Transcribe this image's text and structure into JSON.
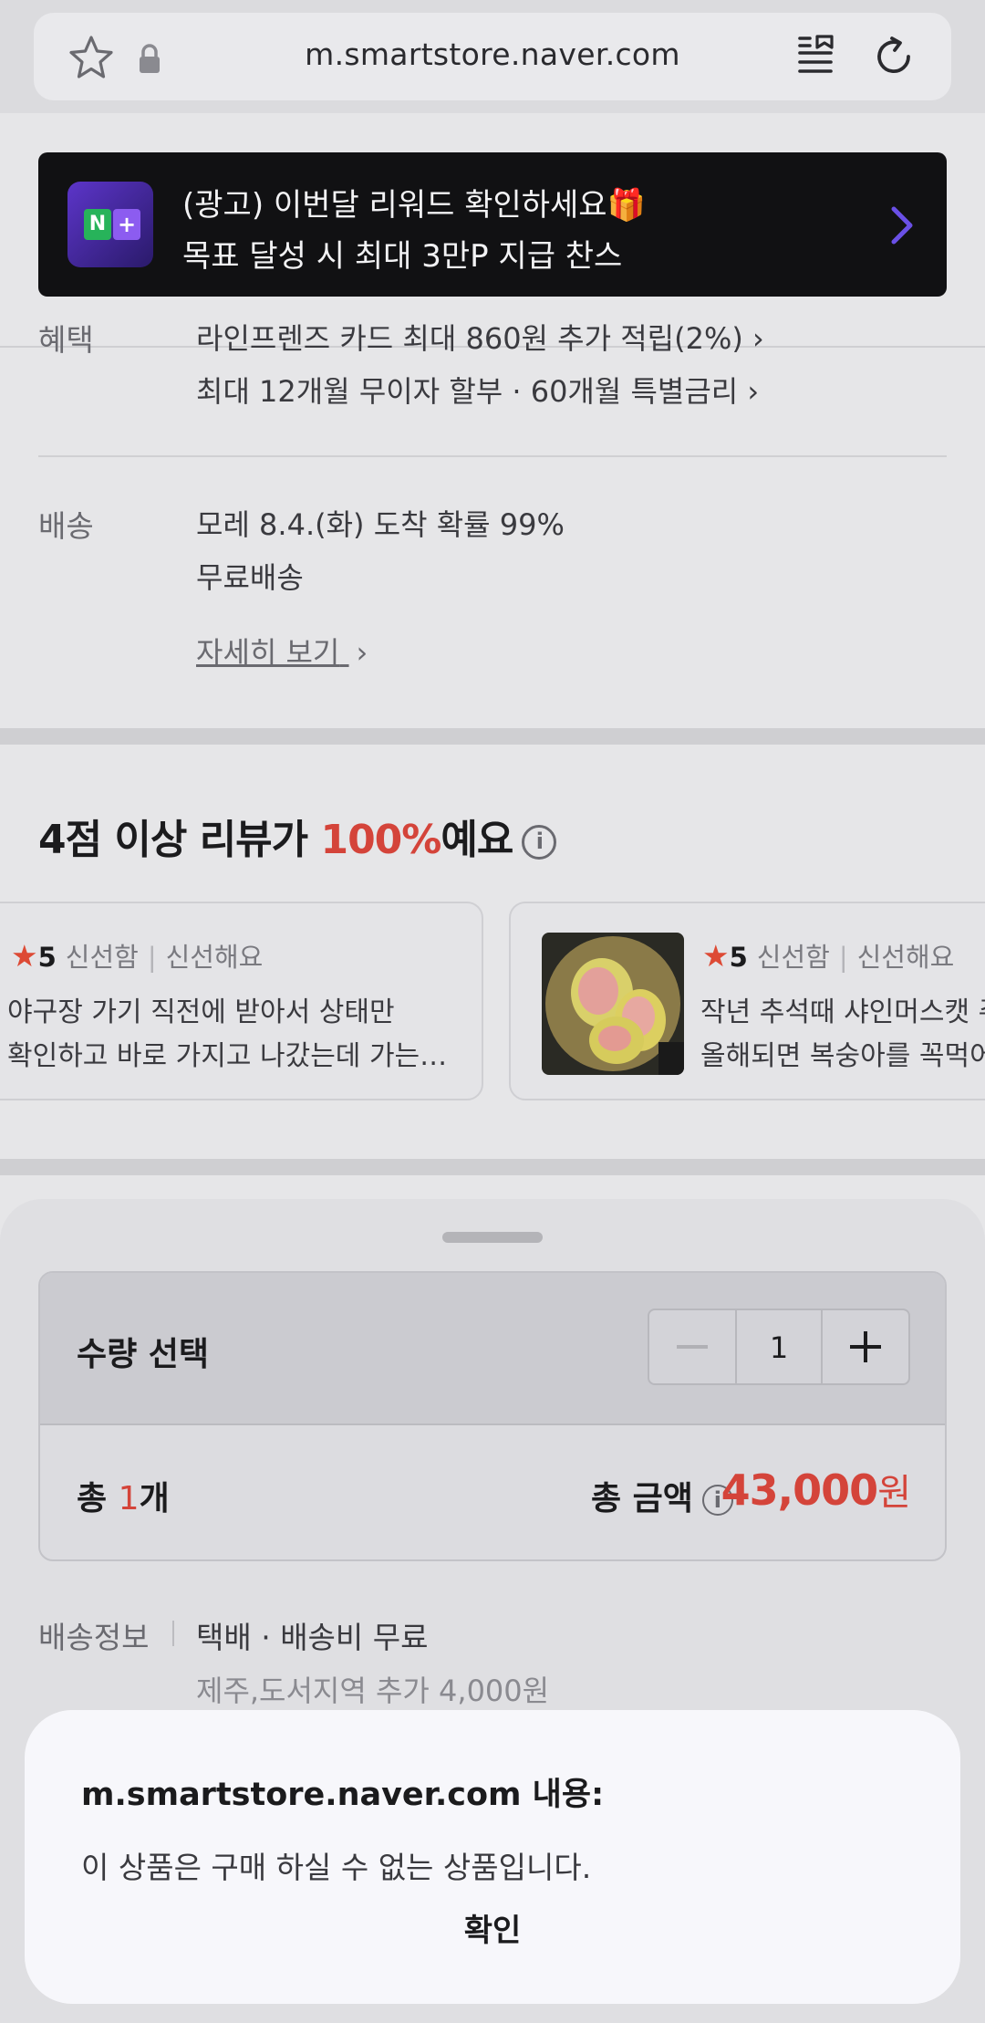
{
  "browser": {
    "url": "m.smartstore.naver.com",
    "icons": [
      "star-icon",
      "lock-icon",
      "reader-mode-icon",
      "reload-icon"
    ]
  },
  "ad": {
    "line1": "(광고) 이번달 리워드 확인하세요🎁",
    "line2": "목표 달성 시 최대 3만P 지급 찬스",
    "logo_letters": [
      "N",
      "+"
    ]
  },
  "benefits": {
    "label": "혜택",
    "line1": "라인프렌즈 카드 최대 860원 추가 적립(2%) ›",
    "line2": "최대 12개월 무이자 할부 · 60개월 특별금리 ›"
  },
  "delivery": {
    "label": "배송",
    "line1": "모레 8.4.(화) 도착 확률 99%",
    "line2": "무료배송",
    "more_link": "자세히 보기"
  },
  "reviews": {
    "title_pre": "4점 이상 리뷰가 ",
    "title_pct": "100%",
    "title_post": "예요",
    "items": [
      {
        "score": "5",
        "tag1": "신선함",
        "tag2": "신선해요",
        "line1": "야구장 가기 직전에 받아서 상태만",
        "line2": "확인하고 바로 가지고 나갔는데 가는…"
      },
      {
        "score": "5",
        "tag1": "신선함",
        "tag2": "신선해요",
        "line1": "작년 추석때 샤인머스캣 주",
        "line2": "올해되면 복숭아를 꼭먹어"
      }
    ]
  },
  "sheet": {
    "qty_label": "수량 선택",
    "qty_value": "1",
    "total_pre": "총 ",
    "total_count": "1",
    "total_post": "개",
    "amount_label": "총 금액",
    "amount_value": "43,000",
    "amount_unit": "원",
    "ship_label": "배송정보",
    "ship_value": "택배 · 배송비 무료",
    "ship_extra": "제주,도서지역 추가 4,000원"
  },
  "dialog": {
    "title": "m.smartstore.naver.com 내용:",
    "message": "이 상품은 구매 하실 수 없는 상품입니다.",
    "confirm": "확인"
  },
  "colors": {
    "accent_red": "#d4443a",
    "ad_bg": "#111113",
    "ad_arrow": "#6a50e6",
    "star": "#dd4a35"
  }
}
